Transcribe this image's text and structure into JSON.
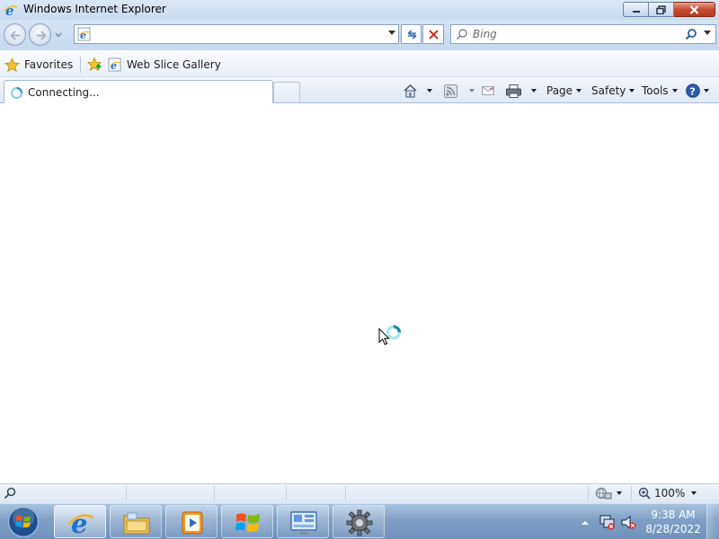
{
  "window": {
    "title": "Windows Internet Explorer",
    "icon": "ie-icon"
  },
  "navigation": {
    "back_icon": "back-arrow-icon",
    "forward_icon": "forward-arrow-icon",
    "address_value": "",
    "search_placeholder": "Bing"
  },
  "favorites_bar": {
    "favorites_label": "Favorites",
    "items": [
      {
        "label": "Web Slice Gallery",
        "icon": "ie-page-icon"
      }
    ]
  },
  "tabs": [
    {
      "label": "Connecting...",
      "icon": "loading-spinner-icon",
      "active": true
    }
  ],
  "command_bar": {
    "page_label": "Page",
    "safety_label": "Safety",
    "tools_label": "Tools"
  },
  "status_bar": {
    "zoom": "100%"
  },
  "taskbar": {
    "clock_time": "9:38 AM",
    "clock_date": "8/28/2022",
    "pinned": [
      "internet-explorer",
      "windows-explorer",
      "windows-media-player",
      "windows-update",
      "control-panel",
      "gear"
    ]
  },
  "colors": {
    "accent": "#1e6fc5",
    "close_button": "#c74a31",
    "taskbar": "#7f9fc6"
  }
}
